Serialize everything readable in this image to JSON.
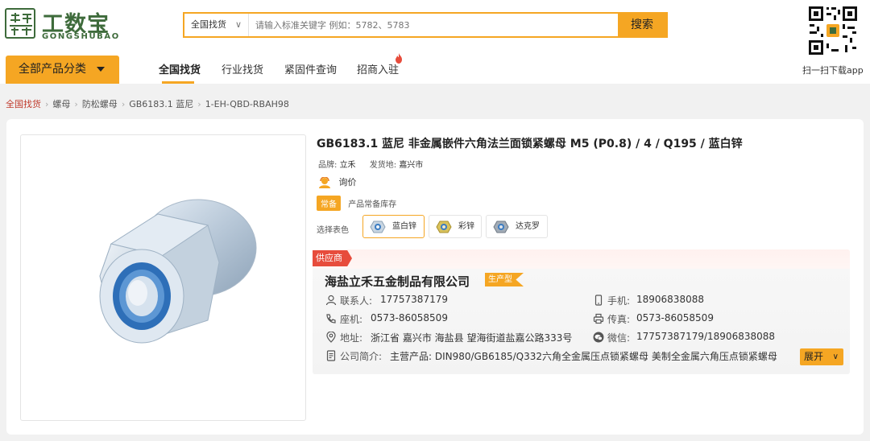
{
  "brand": {
    "name_cn": "工数宝",
    "name_en": "GONGSHUBAO",
    "color": "#3e6b3b"
  },
  "search": {
    "scope": "全国找货",
    "placeholder": "请输入标准关键字 例如：5782、5783",
    "button": "搜索"
  },
  "app_download": {
    "label": "扫一扫下载app",
    "qr_icon": "qr-code-icon"
  },
  "category_button": {
    "label": "全部产品分类"
  },
  "nav": [
    {
      "label": "全国找货",
      "active": true
    },
    {
      "label": "行业找货",
      "active": false
    },
    {
      "label": "紧固件查询",
      "active": false
    },
    {
      "label": "招商入驻",
      "active": false,
      "badge_icon": "fire-icon"
    }
  ],
  "breadcrumb": [
    "全国找货",
    "螺母",
    "防松螺母",
    "GB6183.1 蓝尼",
    "1-EH-QBD-RBAH98"
  ],
  "product": {
    "title": "GB6183.1 蓝尼 非金属嵌件六角法兰面锁紧螺母 M5 (P0.8) / 4 / Q195 / 蓝白锌",
    "brand_label": "品牌:",
    "brand": "立禾",
    "origin_label": "发货地:",
    "origin": "嘉兴市",
    "price": "询价",
    "stock_tag": "常备",
    "stock_text": "产品常备库存",
    "options_label": "选择表色",
    "options": [
      {
        "label": "蓝白锌",
        "selected": true,
        "color": "#7fb3d9"
      },
      {
        "label": "彩锌",
        "selected": false,
        "color": "#d4b84a"
      },
      {
        "label": "达克罗",
        "selected": false,
        "color": "#9aa4b0"
      }
    ]
  },
  "supplier": {
    "tag": "供应商",
    "company": "海盐立禾五金制品有限公司",
    "type": "生产型",
    "contact_label": "联系人:",
    "contact": "17757387179",
    "mobile_label": "手机:",
    "mobile": "18906838088",
    "phone_label": "座机:",
    "phone": "0573-86058509",
    "fax_label": "传真:",
    "fax": "0573-86058509",
    "address_label": "地址:",
    "address": "浙江省 嘉兴市 海盐县 望海街道盐嘉公路333号",
    "wechat_label": "微信:",
    "wechat": "17757387179/18906838088",
    "intro_label": "公司简介:",
    "intro": "主营产品: DIN980/GB6185/Q332六角全金属压点锁紧螺母 美制全金属六角压点锁紧螺母",
    "expand": "展开"
  },
  "colors": {
    "accent": "#f5a623",
    "supplier_tag": "#e74c3c"
  }
}
